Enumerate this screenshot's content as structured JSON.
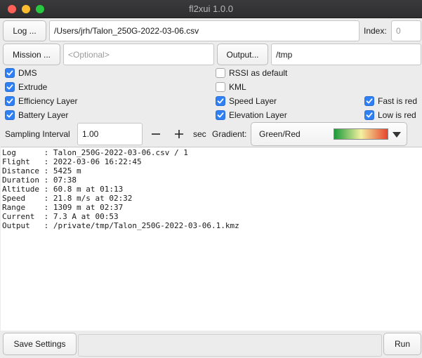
{
  "window": {
    "title": "fl2xui 1.0.0"
  },
  "log": {
    "button_label": "Log ...",
    "path": "/Users/jrh/Talon_250G-2022-03-06.csv",
    "index_label": "Index:",
    "index_value": "0"
  },
  "mission": {
    "button_label": "Mission ...",
    "placeholder": "<Optional>"
  },
  "output_dir": {
    "button_label": "Output...",
    "value": "/tmp"
  },
  "options": {
    "dms": {
      "label": "DMS",
      "checked": true
    },
    "extrude": {
      "label": "Extrude",
      "checked": true
    },
    "efficiency_layer": {
      "label": "Efficiency Layer",
      "checked": true
    },
    "battery_layer": {
      "label": "Battery Layer",
      "checked": true
    },
    "rssi_default": {
      "label": "RSSI as default",
      "checked": false
    },
    "kml": {
      "label": "KML",
      "checked": false
    },
    "speed_layer": {
      "label": "Speed Layer",
      "checked": true
    },
    "elevation_layer": {
      "label": "Elevation Layer",
      "checked": true
    },
    "fast_is_red": {
      "label": "Fast is red",
      "checked": true
    },
    "low_is_red": {
      "label": "Low is red",
      "checked": true
    }
  },
  "sampling": {
    "label": "Sampling Interval",
    "value": "1.00",
    "unit": "sec"
  },
  "gradient": {
    "label": "Gradient:",
    "selected": "Green/Red",
    "colors": [
      "#1a9a3a",
      "#f4f1a0",
      "#e8432e"
    ]
  },
  "output_lines": [
    "Log      : Talon_250G-2022-03-06.csv / 1",
    "Flight   : 2022-03-06 16:22:45",
    "Distance : 5425 m",
    "Duration : 07:38",
    "Altitude : 60.8 m at 01:13",
    "Speed    : 21.8 m/s at 02:32",
    "Range    : 1309 m at 02:37",
    "Current  : 7.3 A at 00:53",
    "Output   : /private/tmp/Talon_250G-2022-03-06.1.kmz"
  ],
  "footer": {
    "save_label": "Save Settings",
    "run_label": "Run"
  },
  "accent_color": "#2f7ff5"
}
